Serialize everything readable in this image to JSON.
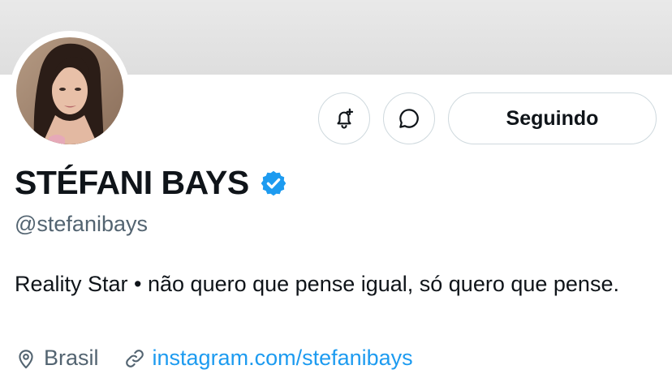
{
  "profile": {
    "display_name": "STÉFANI BAYS",
    "handle": "@stefanibays",
    "bio": "Reality Star • não quero que pense igual, só quero que pense.",
    "location": "Brasil",
    "website": "instagram.com/stefanibays",
    "verified": true
  },
  "actions": {
    "follow_label": "Seguindo",
    "notify_icon": "bell-plus-icon",
    "message_icon": "message-bubble-icon"
  },
  "icons": {
    "verified": "verified-badge-icon",
    "location": "location-pin-icon",
    "link": "link-icon"
  },
  "colors": {
    "link": "#1d9bf0",
    "verified": "#1d9bf0",
    "secondary_text": "#536471",
    "primary_text": "#0f1419",
    "border": "#cfd9de"
  }
}
